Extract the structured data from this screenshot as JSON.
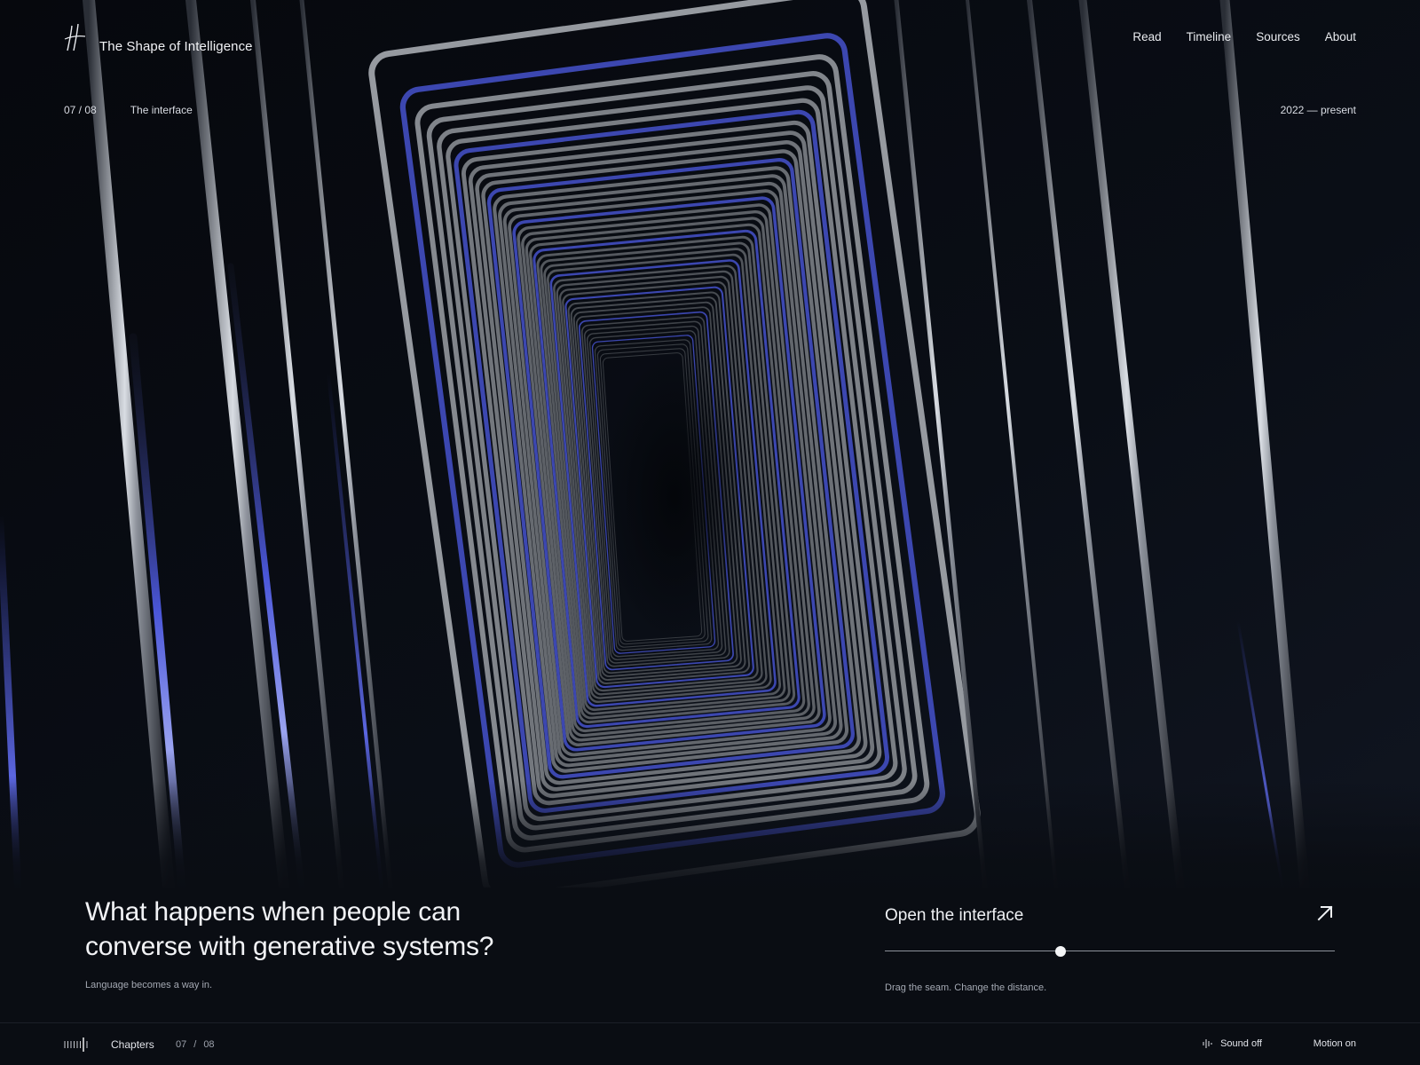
{
  "brand": {
    "title": "The Shape of Intelligence",
    "logo_icon": "hash-stroke-logo"
  },
  "nav": [
    {
      "label": "Read"
    },
    {
      "label": "Timeline"
    },
    {
      "label": "Sources"
    },
    {
      "label": "About"
    }
  ],
  "chapter": {
    "number": "07 / 08",
    "name": "The interface",
    "period": "2022 — present"
  },
  "hero_image": {
    "description": "tunnel-of-metallic-frames",
    "accent_color": "#4b57d9"
  },
  "content": {
    "headline": "What happens when people can converse with generative systems?",
    "subtitle": "Language becomes a way in."
  },
  "cta": {
    "label": "Open the interface",
    "icon": "arrow-up-right-icon",
    "slider_value": 0.39,
    "hint": "Drag the seam. Change the distance."
  },
  "footer": {
    "chapters_label": "Chapters",
    "current": "07",
    "separator": "/",
    "total": "08",
    "sound_label": "Sound off",
    "motion_label": "Motion on"
  },
  "colors": {
    "background": "#0a0d13",
    "text": "#e8eaef",
    "muted": "#a4a9b3",
    "accent_blue": "#4b57d9"
  }
}
